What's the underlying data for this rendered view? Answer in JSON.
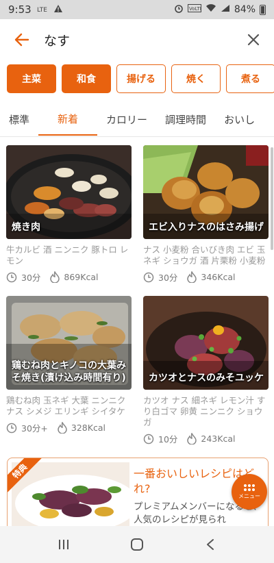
{
  "status_bar": {
    "time": "9:53",
    "battery": "84%",
    "icons": [
      "lte-icon",
      "warning-icon",
      "alarm-icon",
      "volte-icon",
      "wifi-icon",
      "signal-icon",
      "battery-icon"
    ]
  },
  "search": {
    "query": "なす"
  },
  "chips": [
    {
      "label": "主菜",
      "active": true
    },
    {
      "label": "和食",
      "active": true
    },
    {
      "label": "揚げる",
      "active": false
    },
    {
      "label": "焼く",
      "active": false
    },
    {
      "label": "煮る",
      "active": false
    }
  ],
  "sort_tabs": [
    {
      "label": "標準",
      "active": false
    },
    {
      "label": "新着",
      "active": true
    },
    {
      "label": "カロリー",
      "active": false
    },
    {
      "label": "調理時間",
      "active": false
    },
    {
      "label": "おいし",
      "active": false
    }
  ],
  "recipes": [
    {
      "title": "焼き肉",
      "ingredients": "牛カルビ 酒 ニンニク 豚トロ レモン",
      "time": "30分",
      "calories": "869Kcal"
    },
    {
      "title": "エビ入りナスのはさみ揚げ",
      "ingredients": "ナス 小麦粉 合いびき肉 エビ 玉ネギ ショウガ 酒 片栗粉 小麦粉",
      "time": "30分",
      "calories": "346Kcal"
    },
    {
      "title": "鶏むね肉とキノコの大葉みそ焼き(漬け込み時間有り)",
      "ingredients": "鶏むね肉 玉ネギ 大葉 ニンニク ナス シメジ エリンギ シイタケ",
      "time": "30分+",
      "calories": "328Kcal"
    },
    {
      "title": "カツオとナスのみそユッケ",
      "ingredients": "カツオ ナス 細ネギ レモン汁 すり白ゴマ 卵黄 ニンニク ショウガ",
      "time": "10分",
      "calories": "243Kcal"
    }
  ],
  "premium": {
    "ribbon": "特典",
    "title": "一番おいしいレシピはどれ?",
    "body": "プレミアムメンバーになると、人気のレシピが見られ"
  },
  "fab": {
    "label": "メニュー"
  },
  "colors": {
    "accent": "#e8620f",
    "status_bar_bg": "#dcdcdc",
    "nav_bar_bg": "#f4f4f4"
  }
}
